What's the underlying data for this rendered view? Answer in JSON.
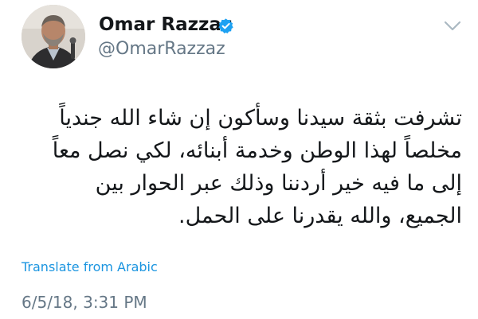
{
  "user": {
    "display_name": "Omar Razzaz",
    "handle": "@OmarRazzaz",
    "verified": true
  },
  "icons": {
    "verified": "verified-badge-icon",
    "menu": "chevron-down-icon",
    "avatar": "profile-photo"
  },
  "colors": {
    "verified_blue": "#1da1f2",
    "link": "#1b95e0",
    "secondary_text": "#657786",
    "primary_text": "#14171a"
  },
  "tweet": {
    "lines": [
      "تشرفت بثقة سيدنا وسأكون إن شاء الله  جندياً",
      "مخلصاً لهذا الوطن وخدمة أبنائه، لكي نصل معاً",
      "إلى ما فيه خير أردننا وذلك عبر الحوار بين",
      "الجميع، والله يقدرنا على الحمل."
    ],
    "translate_label": "Translate from Arabic",
    "timestamp": "6/5/18, 3:31 PM"
  }
}
